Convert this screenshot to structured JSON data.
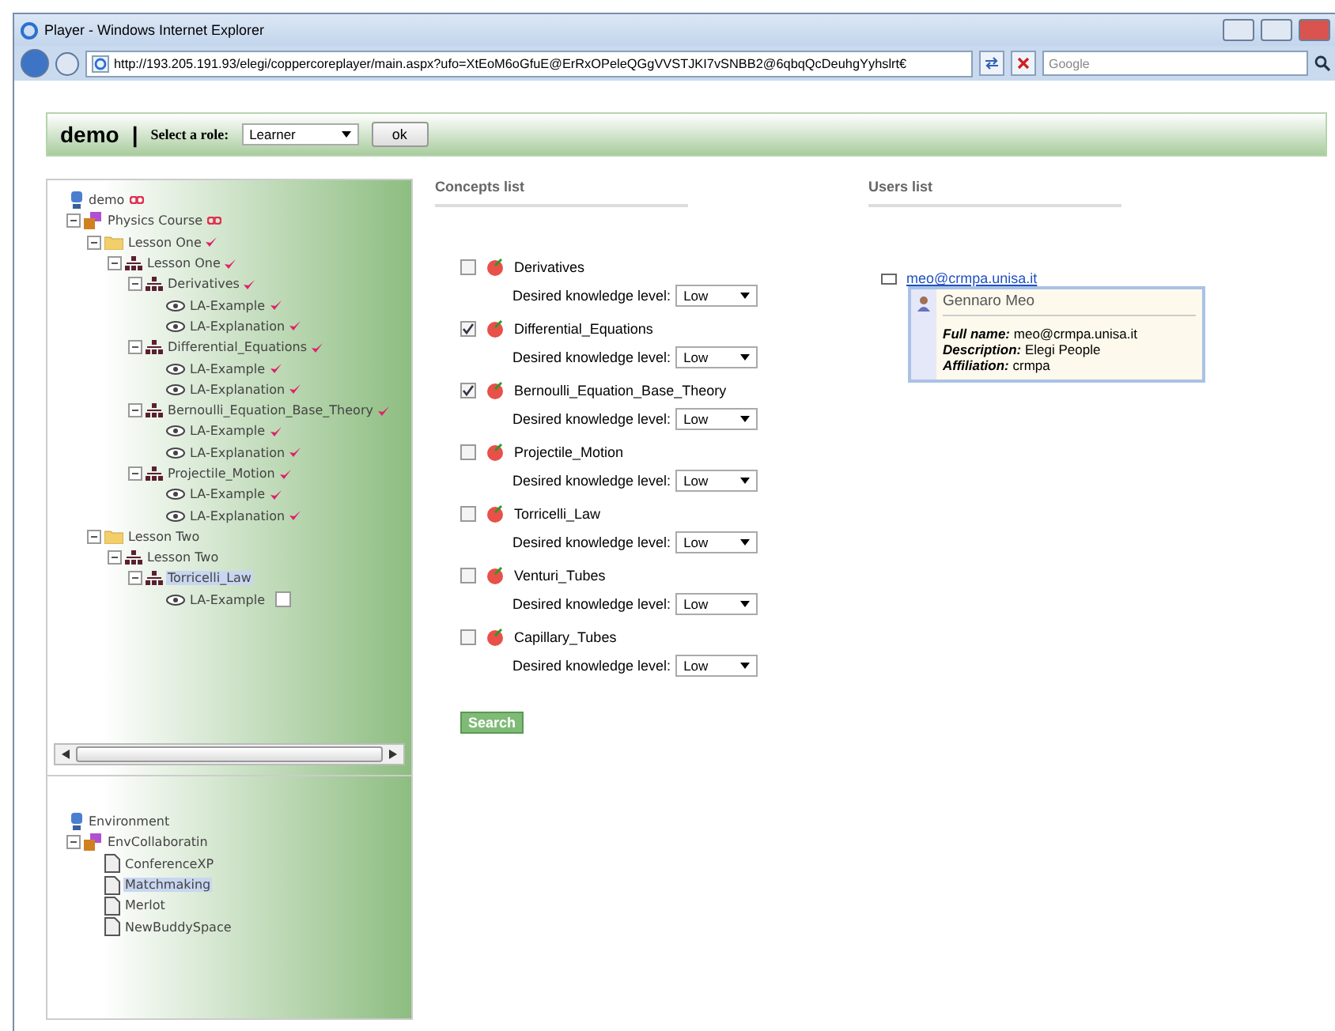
{
  "window": {
    "title": "Player - Windows Internet Explorer"
  },
  "address_bar": {
    "url": "http://193.205.191.93/elegi/coppercoreplayer/main.aspx?ufo=XtEoM6oGfuE@ErRxOPeleQGgVVSTJKI7vSNBB2@6qbqQcDeuhgYyhslrt€"
  },
  "search_box": {
    "placeholder": "Google"
  },
  "header": {
    "title": "demo",
    "separator": "|",
    "role_label": "Select a role:",
    "role_value": "Learner",
    "ok_button": "ok"
  },
  "course_tree": [
    {
      "label": "demo",
      "kind": "user",
      "done": false,
      "started": true,
      "selected": false
    },
    {
      "label": "Physics Course",
      "kind": "course",
      "done": false,
      "started": true,
      "selected": false,
      "children": [
        {
          "label": "Lesson One",
          "kind": "folder",
          "done": true,
          "started": false,
          "selected": false,
          "children": [
            {
              "label": "Lesson One",
              "kind": "unit",
              "done": true,
              "started": false,
              "selected": false,
              "children": [
                {
                  "label": "Derivatives",
                  "kind": "unit",
                  "done": true,
                  "started": false,
                  "selected": false,
                  "children": [
                    {
                      "label": "LA-Example",
                      "kind": "activity",
                      "done": true,
                      "started": false,
                      "selected": false
                    },
                    {
                      "label": "LA-Explanation",
                      "kind": "activity",
                      "done": true,
                      "started": false,
                      "selected": false
                    }
                  ]
                },
                {
                  "label": "Differential_Equations",
                  "kind": "unit",
                  "done": true,
                  "started": false,
                  "selected": false,
                  "children": [
                    {
                      "label": "LA-Example",
                      "kind": "activity",
                      "done": true,
                      "started": false,
                      "selected": false
                    },
                    {
                      "label": "LA-Explanation",
                      "kind": "activity",
                      "done": true,
                      "started": false,
                      "selected": false
                    }
                  ]
                },
                {
                  "label": "Bernoulli_Equation_Base_Theory",
                  "kind": "unit",
                  "done": true,
                  "started": false,
                  "selected": false,
                  "children": [
                    {
                      "label": "LA-Example",
                      "kind": "activity",
                      "done": true,
                      "started": false,
                      "selected": false
                    },
                    {
                      "label": "LA-Explanation",
                      "kind": "activity",
                      "done": true,
                      "started": false,
                      "selected": false
                    }
                  ]
                },
                {
                  "label": "Projectile_Motion",
                  "kind": "unit",
                  "done": true,
                  "started": false,
                  "selected": false,
                  "children": [
                    {
                      "label": "LA-Example",
                      "kind": "activity",
                      "done": true,
                      "started": false,
                      "selected": false
                    },
                    {
                      "label": "LA-Explanation",
                      "kind": "activity",
                      "done": true,
                      "started": false,
                      "selected": false
                    }
                  ]
                }
              ]
            }
          ]
        },
        {
          "label": "Lesson Two",
          "kind": "folder",
          "done": false,
          "started": false,
          "selected": false,
          "children": [
            {
              "label": "Lesson Two",
              "kind": "unit",
              "done": false,
              "started": false,
              "selected": false,
              "children": [
                {
                  "label": "Torricelli_Law",
                  "kind": "unit",
                  "done": false,
                  "started": false,
                  "selected": true,
                  "children": [
                    {
                      "label": "LA-Example",
                      "kind": "activity",
                      "done": false,
                      "started": false,
                      "selected": false,
                      "checked": false
                    }
                  ]
                }
              ]
            }
          ]
        }
      ]
    }
  ],
  "environment_tree": [
    {
      "label": "Environment",
      "kind": "user",
      "done": false,
      "started": false,
      "selected": false
    },
    {
      "label": "EnvCollaboratin",
      "kind": "course",
      "done": false,
      "started": false,
      "selected": false,
      "children": [
        {
          "label": "ConferenceXP",
          "kind": "document",
          "done": false,
          "started": false,
          "selected": false
        },
        {
          "label": "Matchmaking",
          "kind": "document",
          "done": false,
          "started": false,
          "selected": true
        },
        {
          "label": "Merlot",
          "kind": "document",
          "done": false,
          "started": false,
          "selected": false
        },
        {
          "label": "NewBuddySpace",
          "kind": "document",
          "done": false,
          "started": false,
          "selected": false
        }
      ]
    }
  ],
  "concepts": {
    "title": "Concepts list",
    "items": [
      {
        "label": "Derivatives",
        "checked": false,
        "level_label": "Desired knowledge level:",
        "level_value": "Low"
      },
      {
        "label": "Differential_Equations",
        "checked": true,
        "level_label": "Desired knowledge level:",
        "level_value": "Low"
      },
      {
        "label": "Bernoulli_Equation_Base_Theory",
        "checked": true,
        "level_label": "Desired knowledge level:",
        "level_value": "Low"
      },
      {
        "label": "Projectile_Motion",
        "checked": false,
        "level_label": "Desired knowledge level:",
        "level_value": "Low"
      },
      {
        "label": "Torricelli_Law",
        "checked": false,
        "level_label": "Desired knowledge level:",
        "level_value": "Low"
      },
      {
        "label": "Venturi_Tubes",
        "checked": false,
        "level_label": "Desired knowledge level:",
        "level_value": "Low"
      },
      {
        "label": "Capillary_Tubes",
        "checked": false,
        "level_label": "Desired knowledge level:",
        "level_value": "Low"
      }
    ],
    "search_button": "Search"
  },
  "users": {
    "title": "Users list",
    "items": [
      {
        "email": "meo@crmpa.unisa.it",
        "name": "Gennaro Meo",
        "fields": [
          {
            "label": "Full name:",
            "value": "meo@crmpa.unisa.it"
          },
          {
            "label": "Description:",
            "value": "Elegi People"
          },
          {
            "label": "Affiliation:",
            "value": "crmpa"
          }
        ]
      }
    ]
  }
}
